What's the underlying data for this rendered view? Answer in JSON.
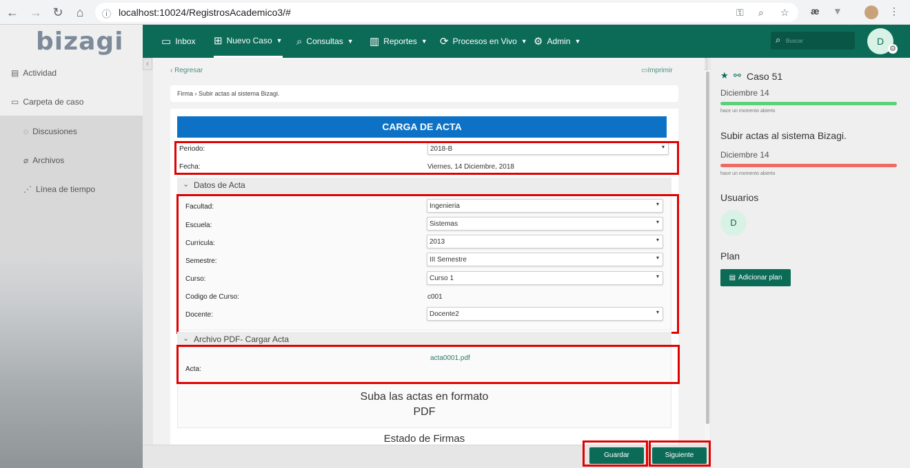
{
  "browser": {
    "url": "localhost:10024/RegistrosAcademico3/#"
  },
  "header": {
    "logo": "bizagi",
    "nav": [
      {
        "label": "Inbox",
        "icon": "inbox-icon"
      },
      {
        "label": "Nuevo Caso",
        "icon": "new-case-icon"
      },
      {
        "label": "Consultas",
        "icon": "search-icon"
      },
      {
        "label": "Reportes",
        "icon": "chart-icon"
      },
      {
        "label": "Procesos en Vivo",
        "icon": "live-process-icon"
      },
      {
        "label": "Admin",
        "icon": "gear-icon"
      }
    ],
    "search_placeholder": "Buscar",
    "avatar_initial": "D"
  },
  "sidebar": {
    "items": [
      {
        "label": "Actividad",
        "icon": "document-icon"
      },
      {
        "label": "Carpeta de caso",
        "icon": "folder-icon"
      }
    ],
    "subitems": [
      {
        "label": "Discusiones",
        "icon": "chat-icon"
      },
      {
        "label": "Archivos",
        "icon": "paperclip-icon"
      },
      {
        "label": "Línea de tiempo",
        "icon": "timeline-icon"
      }
    ]
  },
  "main": {
    "back_label": "Regresar",
    "print_label": "Imprimir",
    "breadcrumb": "Firma › Subir actas al sistema Bizagi.",
    "form_title": "CARGA DE ACTA",
    "periodo_label": "Periodo:",
    "periodo_value": "2018-B",
    "fecha_label": "Fecha:",
    "fecha_value": "Viernes, 14 Diciembre, 2018",
    "datos_section": "Datos de Acta",
    "fields": [
      {
        "label": "Facultad:",
        "value": "Ingenieria",
        "type": "select"
      },
      {
        "label": "Escuela:",
        "value": "Sistemas",
        "type": "select"
      },
      {
        "label": "Curricula:",
        "value": "2013",
        "type": "select"
      },
      {
        "label": "Semestre:",
        "value": "III Semestre",
        "type": "select"
      },
      {
        "label": "Curso:",
        "value": "Curso 1",
        "type": "select"
      },
      {
        "label": "Codigo de Curso:",
        "value": "c001",
        "type": "text"
      },
      {
        "label": "Docente:",
        "value": "Docente2",
        "type": "select"
      }
    ],
    "archivo_section": "Archivo PDF- Cargar Acta",
    "acta_label": "Acta:",
    "acta_file": "acta0001.pdf",
    "pdf_note_line1": "Suba las actas en formato",
    "pdf_note_line2": "PDF",
    "estado_title": "Estado de Firmas"
  },
  "footer": {
    "save_label": "Guardar",
    "next_label": "Siguiente"
  },
  "right_panel": {
    "case_title": "Caso 51",
    "case_date": "Diciembre 14",
    "case_opened": "hace un momento abierto",
    "task_title": "Subir actas al sistema Bizagi.",
    "task_date": "Diciembre 14",
    "task_opened": "hace un momento abierto",
    "users_title": "Usuarios",
    "user_initial": "D",
    "plan_title": "Plan",
    "add_plan_label": "Adicionar plan"
  },
  "colors": {
    "brand": "#0c6b57",
    "form_header": "#0d72c6",
    "progress_green": "#5ccf7b",
    "progress_red": "#ee6b63",
    "highlight": "#e00000"
  }
}
